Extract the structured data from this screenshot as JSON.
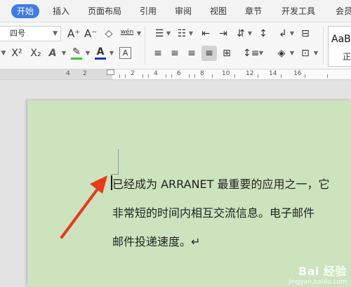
{
  "ribbon": {
    "tabs": [
      "开始",
      "插入",
      "页面布局",
      "引用",
      "审阅",
      "视图",
      "章节",
      "开发工具",
      "会员"
    ],
    "active_tab": "开始"
  },
  "toolbar": {
    "font_size": "四号",
    "grow_font": "A⁺",
    "shrink_font": "A⁻",
    "clear_format": "◇",
    "pinyin": "wén",
    "superscript": "X²",
    "subscript": "X₂",
    "text_effect": "A",
    "highlight": "✎",
    "font_color": "A",
    "char_border": "A",
    "style_preview": "AaB",
    "style_name": "正"
  },
  "ruler": {
    "numbers": [
      "4",
      "2",
      "2",
      "4",
      "6",
      "8",
      "10",
      "12",
      "14",
      "16"
    ]
  },
  "document": {
    "lines": [
      "已经成为 ARRANET 最重要的应用之一，它",
      "非常短的时间内相互交流信息。电子邮件",
      "邮件投递速度。↵"
    ]
  },
  "watermark": {
    "main": "Bai 经验",
    "sub": "jingyan.baidu.com"
  },
  "colors": {
    "page_bg": "#cce3bd",
    "accent": "#3f7ce6",
    "arrow": "#e8391f",
    "highlight_bar": "#33cc33",
    "font_color_bar": "#1a33cc"
  }
}
